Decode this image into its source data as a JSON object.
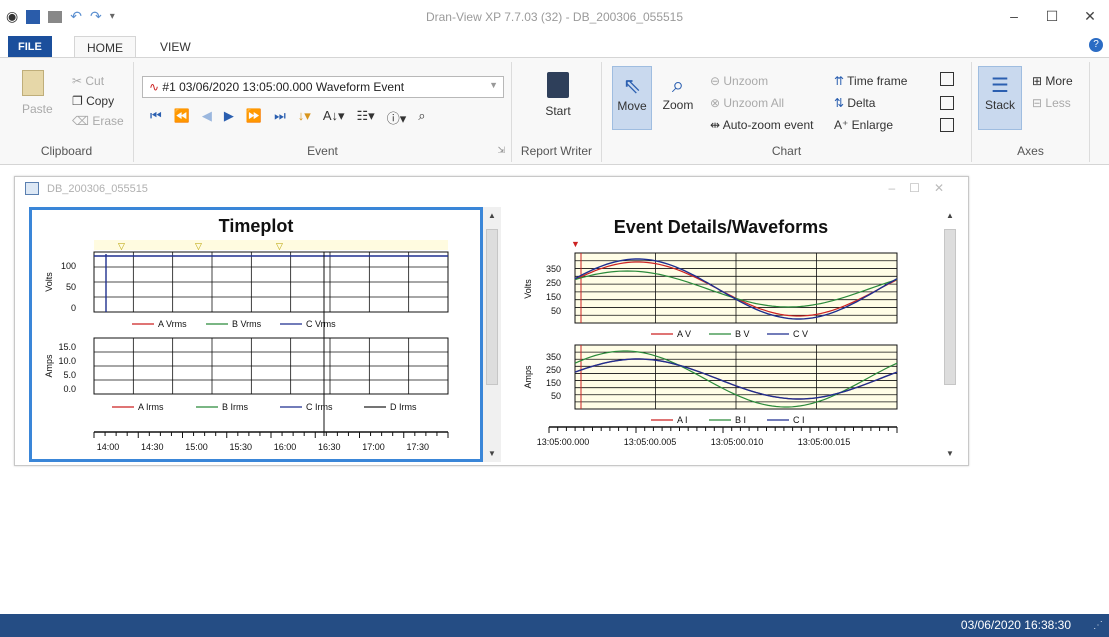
{
  "window": {
    "title": "Dran-View XP 7.7.03 (32) - DB_200306_055515",
    "controls": [
      "minimize-icon",
      "maximize-icon",
      "close-icon"
    ]
  },
  "ribbon_tabs": [
    "FILE",
    "HOME",
    "VIEW"
  ],
  "clipboard": {
    "paste": "Paste",
    "cut": "Cut",
    "copy": "Copy",
    "erase": "Erase",
    "label": "Clipboard"
  },
  "event": {
    "combo_value": "#1 03/06/2020 13:05:00.000  Waveform Event",
    "label": "Event"
  },
  "report": {
    "start": "Start",
    "label": "Report Writer"
  },
  "chart": {
    "move": "Move",
    "zoom": "Zoom",
    "unzoom": "Unzoom",
    "unzoom_all": "Unzoom All",
    "auto_zoom": "Auto-zoom event",
    "time_frame": "Time frame",
    "delta": "Delta",
    "enlarge": "Enlarge",
    "label": "Chart"
  },
  "axes": {
    "stack": "Stack",
    "more": "More",
    "less": "Less",
    "label": "Axes"
  },
  "child_window": {
    "title": "DB_200306_055515"
  },
  "status": {
    "datetime": "03/06/2020 16:38:30"
  },
  "timeplot": {
    "title": "Timeplot",
    "volts_axis": {
      "label": "Volts",
      "ticks": [
        "100",
        "50",
        "0"
      ]
    },
    "amps_axis": {
      "label": "Amps",
      "ticks": [
        "15.0",
        "10.0",
        "5.0",
        "0.0"
      ]
    },
    "volts_legend": [
      "A Vrms",
      "B Vrms",
      "C Vrms"
    ],
    "amps_legend": [
      "A Irms",
      "B Irms",
      "C Irms",
      "D Irms"
    ],
    "time_ticks": [
      "14:00",
      "14:30",
      "15:00",
      "15:30",
      "16:00",
      "16:30",
      "17:00",
      "17:30"
    ],
    "cursor": "16:38:30"
  },
  "waveforms": {
    "title": "Event Details/Waveforms",
    "volts_axis": {
      "label": "Volts",
      "ticks": [
        "350",
        "250",
        "150",
        "50"
      ]
    },
    "amps_axis": {
      "label": "Amps",
      "ticks": [
        "350",
        "250",
        "150",
        "50"
      ]
    },
    "volts_legend": [
      "A V",
      "B V",
      "C V"
    ],
    "amps_legend": [
      "A I",
      "B I",
      "C I"
    ],
    "time_ticks": [
      "13:05:00.000",
      "13:05:00.005",
      "13:05:00.010",
      "13:05:00.015"
    ]
  },
  "colors": {
    "series_a": "#cc2222",
    "series_b": "#2a8a3a",
    "series_c": "#1f2f8f",
    "series_d": "#222222",
    "status_bar": "#254d84",
    "accent": "#1b4f9c"
  }
}
